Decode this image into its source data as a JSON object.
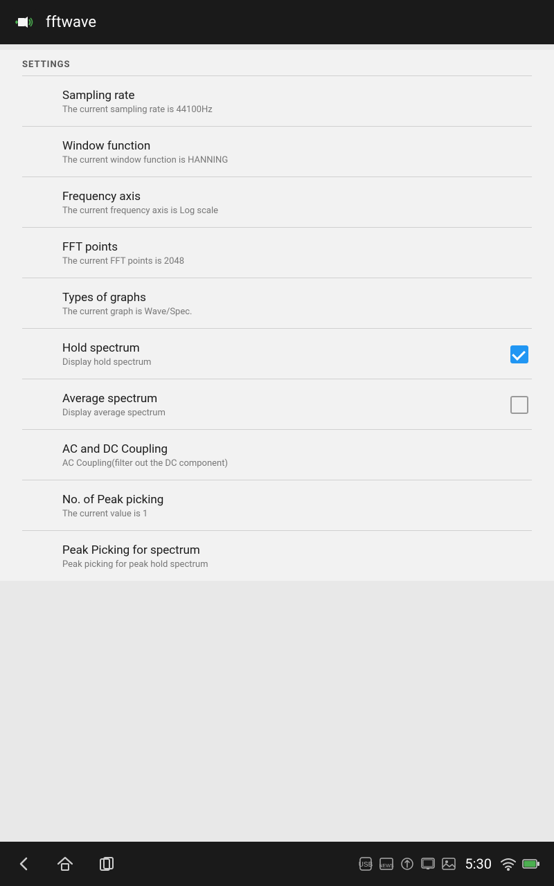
{
  "app": {
    "title": "fftwave"
  },
  "settings": {
    "section_label": "SETTINGS",
    "items": [
      {
        "id": "sampling-rate",
        "title": "Sampling rate",
        "subtitle": "The current sampling rate is 44100Hz",
        "has_checkbox": false,
        "checked": null
      },
      {
        "id": "window-function",
        "title": "Window function",
        "subtitle": "The current window function is HANNING",
        "has_checkbox": false,
        "checked": null
      },
      {
        "id": "frequency-axis",
        "title": "Frequency axis",
        "subtitle": "The current frequency axis is Log scale",
        "has_checkbox": false,
        "checked": null
      },
      {
        "id": "fft-points",
        "title": "FFT points",
        "subtitle": "The current FFT points is 2048",
        "has_checkbox": false,
        "checked": null
      },
      {
        "id": "types-of-graphs",
        "title": "Types of graphs",
        "subtitle": "The current graph is Wave/Spec.",
        "has_checkbox": false,
        "checked": null
      },
      {
        "id": "hold-spectrum",
        "title": "Hold spectrum",
        "subtitle": "Display hold spectrum",
        "has_checkbox": true,
        "checked": true
      },
      {
        "id": "average-spectrum",
        "title": "Average spectrum",
        "subtitle": "Display average spectrum",
        "has_checkbox": true,
        "checked": false
      },
      {
        "id": "ac-dc-coupling",
        "title": "AC and DC Coupling",
        "subtitle": "AC Coupling(filter out the DC component)",
        "has_checkbox": false,
        "checked": null
      },
      {
        "id": "peak-picking-count",
        "title": "No. of Peak picking",
        "subtitle": "The current value is 1",
        "has_checkbox": false,
        "checked": null
      },
      {
        "id": "peak-picking-spectrum",
        "title": "Peak Picking for spectrum",
        "subtitle": "Peak picking for peak hold spectrum",
        "has_checkbox": false,
        "checked": null
      }
    ]
  },
  "bottom_bar": {
    "time": "5:30",
    "nav_back_label": "back",
    "nav_home_label": "home",
    "nav_recents_label": "recents"
  }
}
